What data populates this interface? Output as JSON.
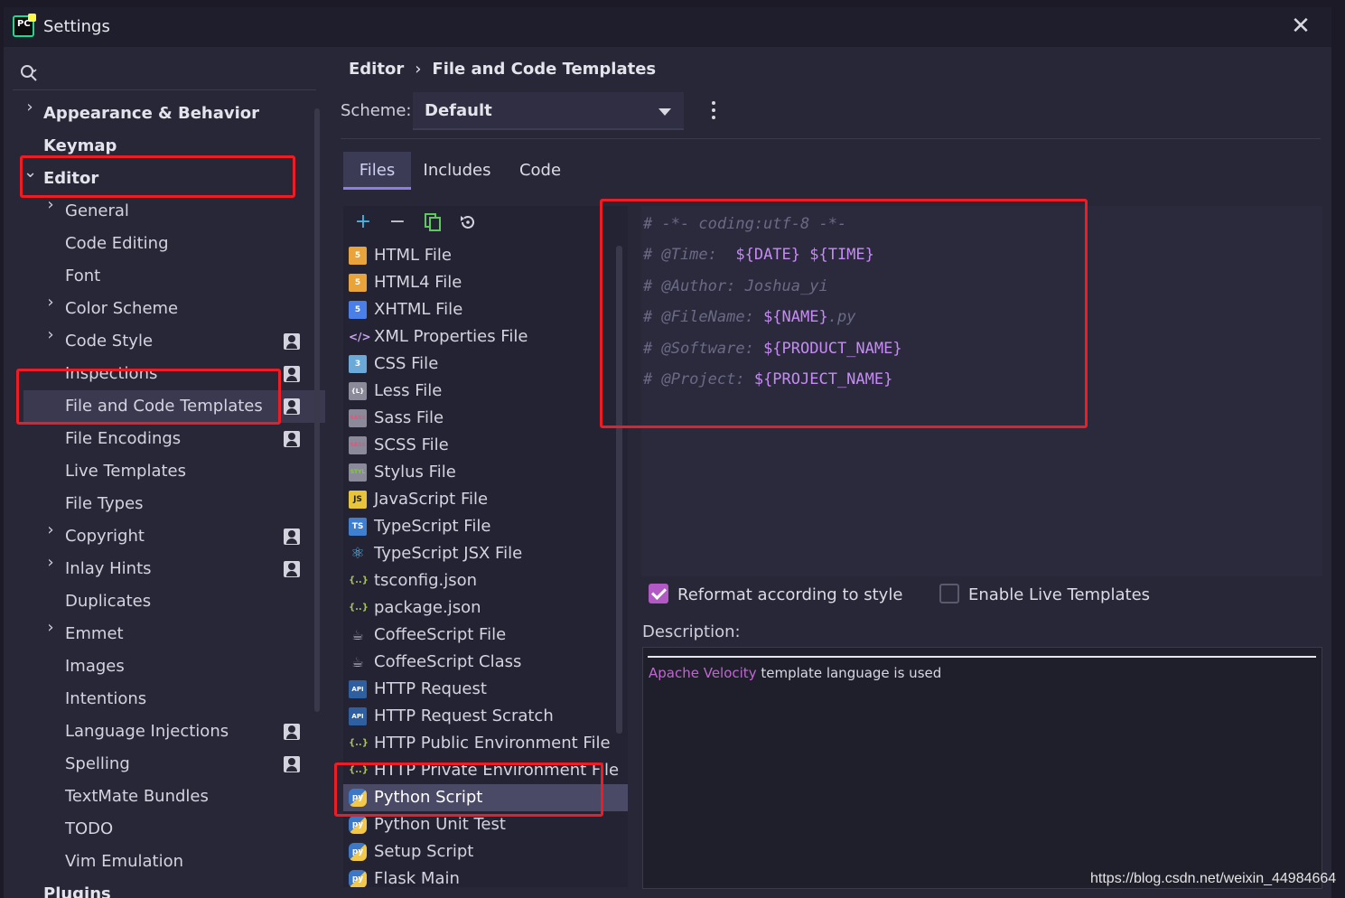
{
  "window": {
    "title": "Settings",
    "close_symbol": "✕",
    "app_icon_text": "PC"
  },
  "left_tree": {
    "items": [
      {
        "label": "Appearance & Behavior"
      },
      {
        "label": "Keymap"
      },
      {
        "label": "Editor"
      },
      {
        "label": "General"
      },
      {
        "label": "Code Editing"
      },
      {
        "label": "Font"
      },
      {
        "label": "Color Scheme"
      },
      {
        "label": "Code Style"
      },
      {
        "label": "Inspections"
      },
      {
        "label": "File and Code Templates"
      },
      {
        "label": "File Encodings"
      },
      {
        "label": "Live Templates"
      },
      {
        "label": "File Types"
      },
      {
        "label": "Copyright"
      },
      {
        "label": "Inlay Hints"
      },
      {
        "label": "Duplicates"
      },
      {
        "label": "Emmet"
      },
      {
        "label": "Images"
      },
      {
        "label": "Intentions"
      },
      {
        "label": "Language Injections"
      },
      {
        "label": "Spelling"
      },
      {
        "label": "TextMate Bundles"
      },
      {
        "label": "TODO"
      },
      {
        "label": "Vim Emulation"
      },
      {
        "label": "Plugins"
      }
    ]
  },
  "breadcrumb": {
    "parent": "Editor",
    "separator": "›",
    "current": "File and Code Templates"
  },
  "scheme": {
    "label": "Scheme:",
    "value": "Default"
  },
  "tabs": [
    {
      "label": "Files"
    },
    {
      "label": "Includes"
    },
    {
      "label": "Code"
    }
  ],
  "toolbar": {
    "add": "+",
    "remove": "−"
  },
  "files": [
    {
      "label": "HTML File",
      "badge": "5"
    },
    {
      "label": "HTML4 File",
      "badge": "5"
    },
    {
      "label": "XHTML File",
      "badge": "5"
    },
    {
      "label": "XML Properties File",
      "badge": "</>"
    },
    {
      "label": "CSS File",
      "badge": "3"
    },
    {
      "label": "Less File",
      "badge": "{L}"
    },
    {
      "label": "Sass File",
      "badge": "SASS"
    },
    {
      "label": "SCSS File",
      "badge": "SASS"
    },
    {
      "label": "Stylus File",
      "badge": "STYL"
    },
    {
      "label": "JavaScript File",
      "badge": "JS"
    },
    {
      "label": "TypeScript File",
      "badge": "TS"
    },
    {
      "label": "TypeScript JSX File",
      "badge": "⚛"
    },
    {
      "label": "tsconfig.json",
      "badge": "{..}"
    },
    {
      "label": "package.json",
      "badge": "{..}"
    },
    {
      "label": "CoffeeScript File",
      "badge": "☕"
    },
    {
      "label": "CoffeeScript Class",
      "badge": "☕"
    },
    {
      "label": "HTTP Request",
      "badge": "API"
    },
    {
      "label": "HTTP Request Scratch",
      "badge": "API"
    },
    {
      "label": "HTTP Public Environment File",
      "badge": "{..}"
    },
    {
      "label": "HTTP Private Environment File",
      "badge": "{..}"
    },
    {
      "label": "Python Script",
      "badge": "py"
    },
    {
      "label": "Python Unit Test",
      "badge": "py"
    },
    {
      "label": "Setup Script",
      "badge": "py"
    },
    {
      "label": "Flask Main",
      "badge": "py"
    }
  ],
  "editor_lines": [
    {
      "comment": "# -*- coding:utf-8 -*-",
      "var": "",
      "tail": ""
    },
    {
      "comment": "# @Time:  ",
      "var": "${DATE} ${TIME}",
      "tail": ""
    },
    {
      "comment": "# @Author: Joshua_yi",
      "var": "",
      "tail": ""
    },
    {
      "comment": "# @FileName: ",
      "var": "${NAME}",
      "tail": ".py"
    },
    {
      "comment": "# @Software: ",
      "var": "${PRODUCT_NAME}",
      "tail": ""
    },
    {
      "comment": "# @Project: ",
      "var": "${PROJECT_NAME}",
      "tail": ""
    }
  ],
  "options": {
    "reformat_label": "Reformat according to style",
    "reformat_checked": true,
    "live_templates_label": "Enable Live Templates",
    "live_templates_checked": false
  },
  "description": {
    "label": "Description:",
    "link_text": "Apache Velocity",
    "text": " template language is used"
  },
  "watermark": "https://blog.csdn.net/weixin_44984664",
  "colors": {
    "accent": "#b359c6",
    "annotation": "#ee1c25",
    "variable": "#c68af5"
  }
}
